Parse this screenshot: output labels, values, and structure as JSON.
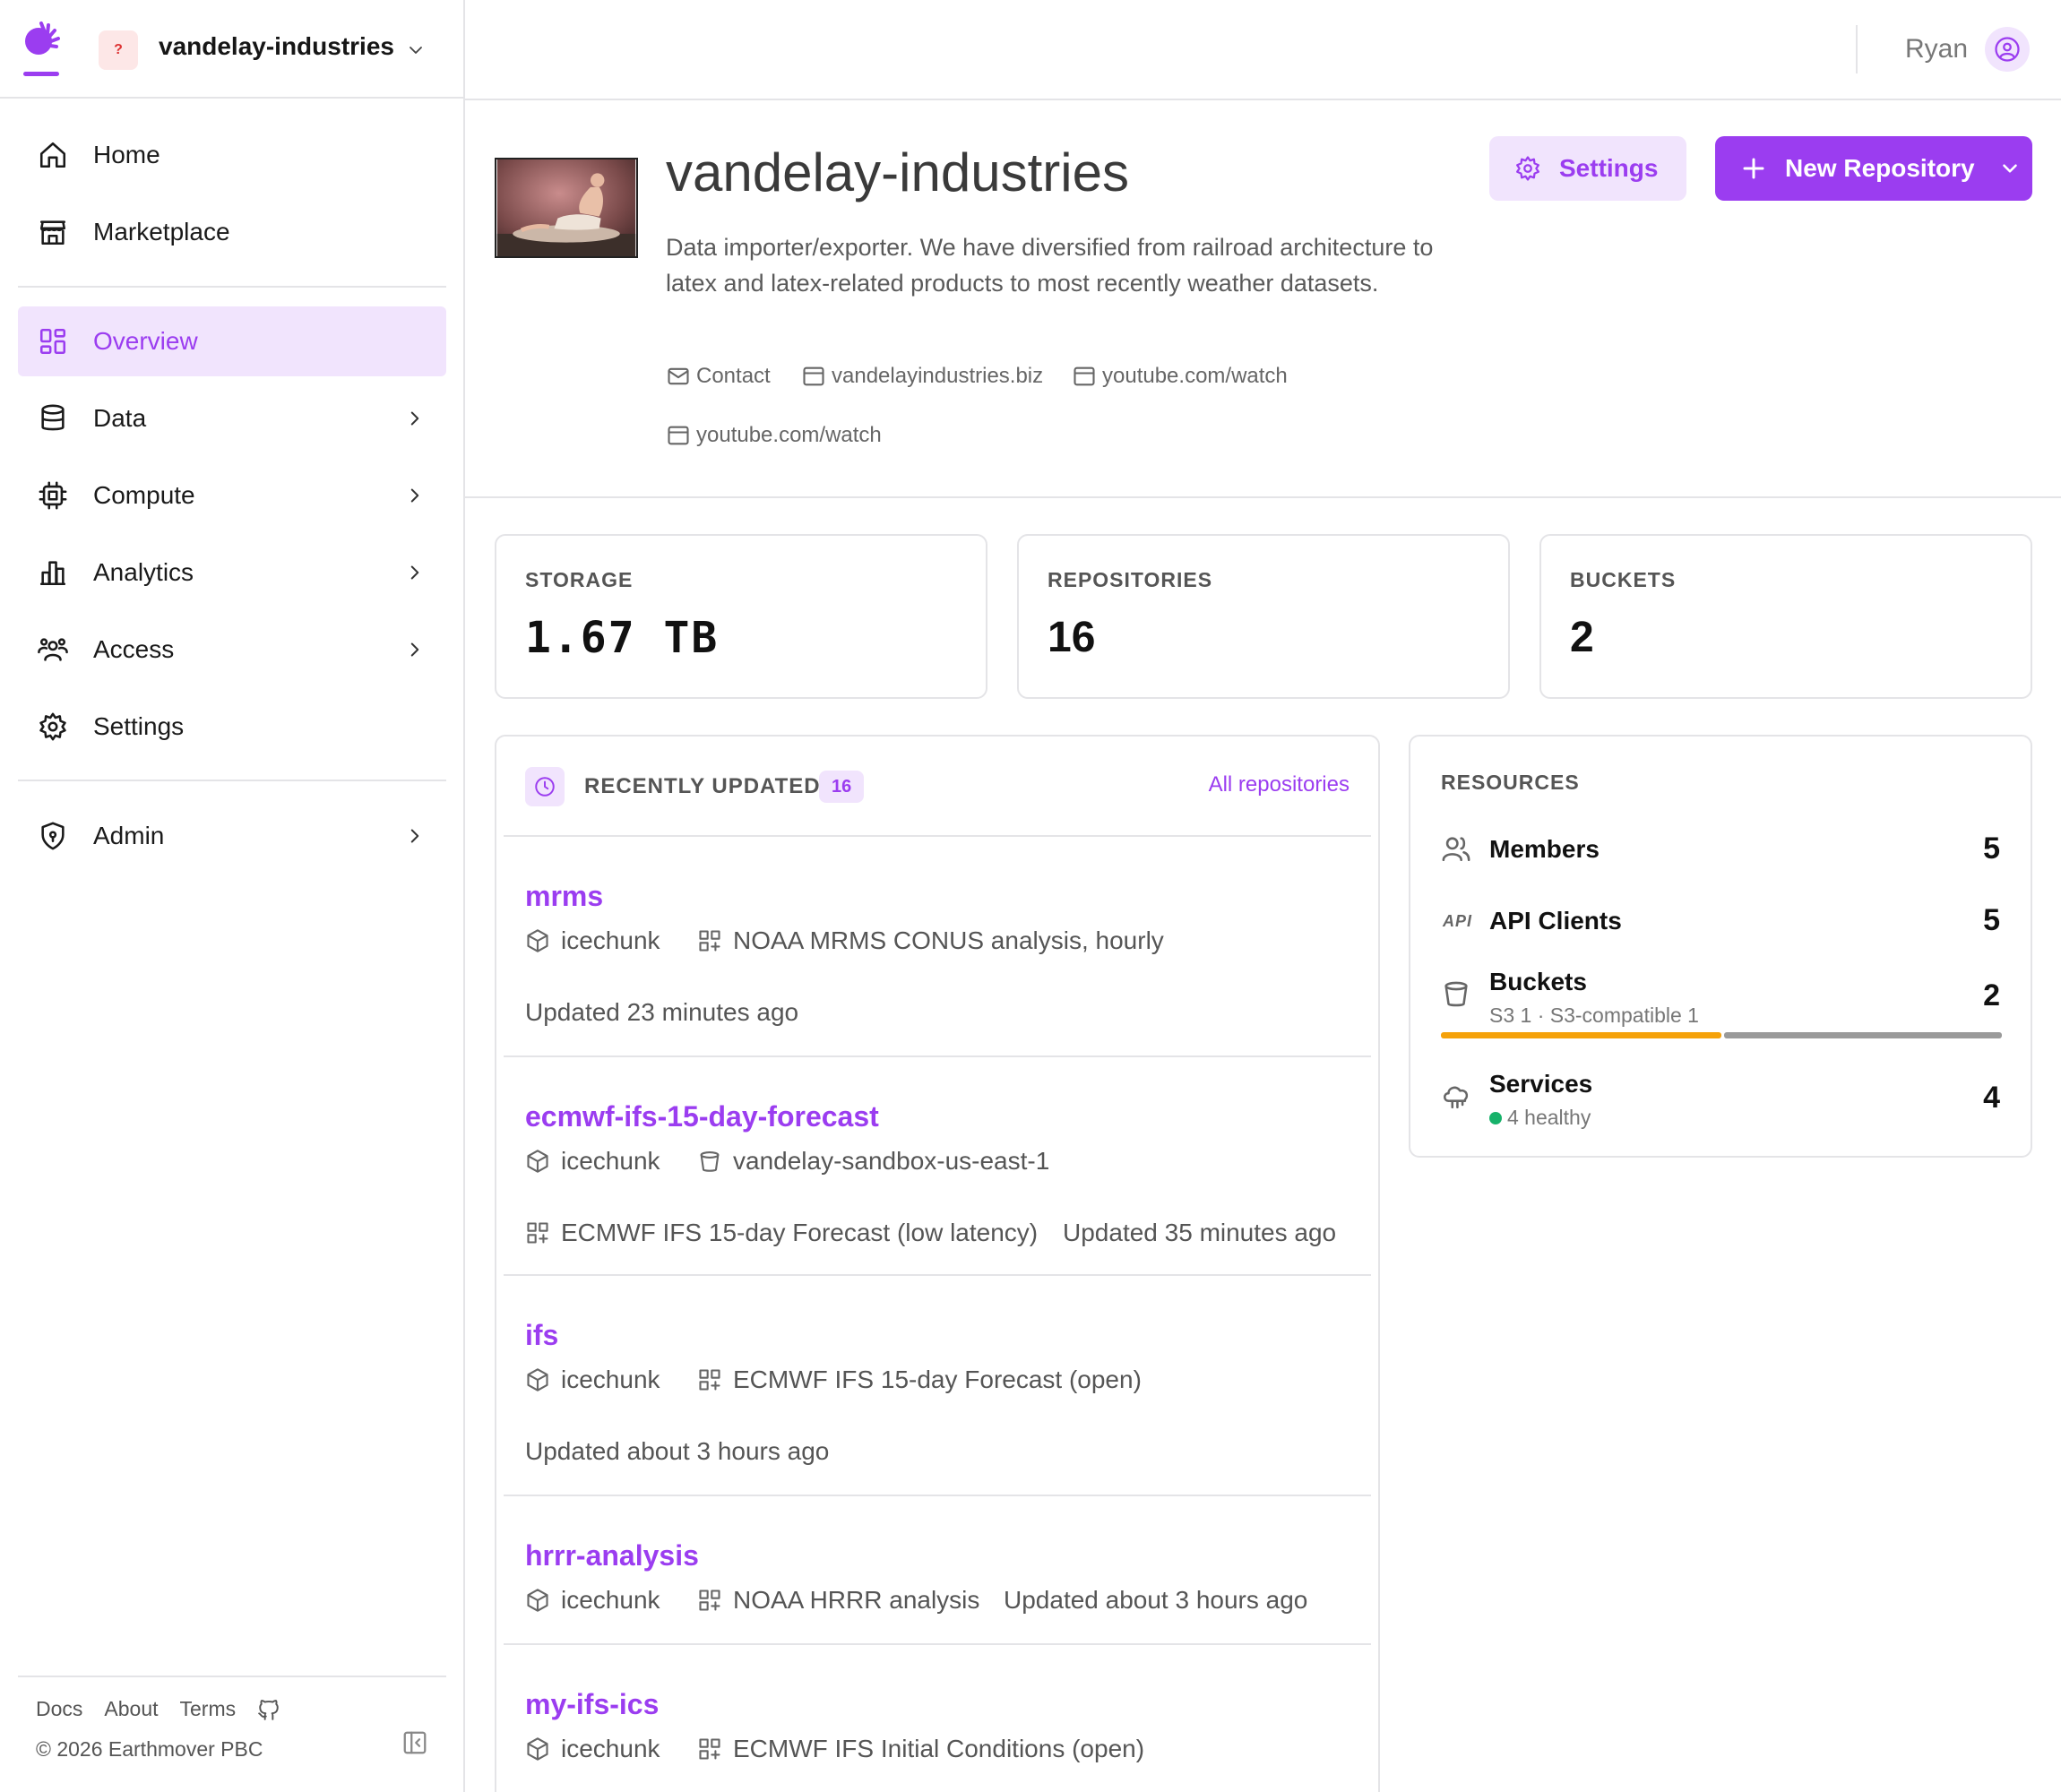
{
  "org": {
    "avatar_text": "?",
    "name": "vandelay-industries"
  },
  "sidebar": {
    "items": [
      {
        "label": "Home",
        "icon": "home-icon"
      },
      {
        "label": "Marketplace",
        "icon": "store-icon"
      },
      {
        "label": "Overview",
        "icon": "grid-icon",
        "active": true
      },
      {
        "label": "Data",
        "icon": "database-icon"
      },
      {
        "label": "Compute",
        "icon": "cpu-icon"
      },
      {
        "label": "Analytics",
        "icon": "bar-chart-icon"
      },
      {
        "label": "Access",
        "icon": "users-icon"
      },
      {
        "label": "Settings",
        "icon": "gear-icon"
      },
      {
        "label": "Admin",
        "icon": "shield-icon"
      }
    ],
    "footer": {
      "docs": "Docs",
      "about": "About",
      "terms": "Terms",
      "copyright": "© 2026 Earthmover PBC"
    }
  },
  "topbar": {
    "user_name": "Ryan"
  },
  "header": {
    "title": "vandelay-industries",
    "description": "Data importer/exporter. We have diversified from railroad architecture to latex and latex-related products to most recently weather datasets.",
    "links": [
      {
        "label": "Contact",
        "icon": "mail-icon"
      },
      {
        "label": "vandelayindustries.biz",
        "icon": "browser-icon"
      },
      {
        "label": "youtube.com/watch",
        "icon": "browser-icon"
      },
      {
        "label": "youtube.com/watch",
        "icon": "browser-icon"
      }
    ],
    "settings_label": "Settings",
    "new_repo_label": "New Repository"
  },
  "stats": [
    {
      "label": "STORAGE",
      "value": "1.67 TB"
    },
    {
      "label": "REPOSITORIES",
      "value": "16"
    },
    {
      "label": "BUCKETS",
      "value": "2"
    }
  ],
  "recent": {
    "title": "RECENTLY UPDATED",
    "count": "16",
    "all_link": "All repositories",
    "repos": [
      {
        "name": "mrms",
        "format": "icechunk",
        "dataset": "NOAA MRMS CONUS analysis, hourly",
        "updated": "Updated 23 minutes ago"
      },
      {
        "name": "ecmwf-ifs-15-day-forecast",
        "format": "icechunk",
        "bucket": "vandelay-sandbox-us-east-1",
        "dataset": "ECMWF IFS 15-day Forecast (low latency)",
        "updated": "Updated 35 minutes ago"
      },
      {
        "name": "ifs",
        "format": "icechunk",
        "dataset": "ECMWF IFS 15-day Forecast (open)",
        "updated": "Updated about 3 hours ago"
      },
      {
        "name": "hrrr-analysis",
        "format": "icechunk",
        "dataset": "NOAA HRRR analysis",
        "updated": "Updated about 3 hours ago"
      },
      {
        "name": "my-ifs-ics",
        "format": "icechunk",
        "dataset": "ECMWF IFS Initial Conditions (open)"
      }
    ]
  },
  "resources": {
    "title": "RESOURCES",
    "members": {
      "label": "Members",
      "value": "5"
    },
    "api_clients": {
      "label": "API Clients",
      "value": "5",
      "icon_text": "API"
    },
    "buckets": {
      "label": "Buckets",
      "value": "2",
      "sub": "S3 1 · S3-compatible 1",
      "s3_fraction": 0.5,
      "colors": [
        "#f5a20a",
        "#9a9a9a"
      ]
    },
    "services": {
      "label": "Services",
      "value": "4",
      "sub": "4 healthy",
      "status_color": "#17b26a"
    }
  },
  "colors": {
    "accent": "#9b3df0",
    "accent_light": "#f1e4fd"
  }
}
